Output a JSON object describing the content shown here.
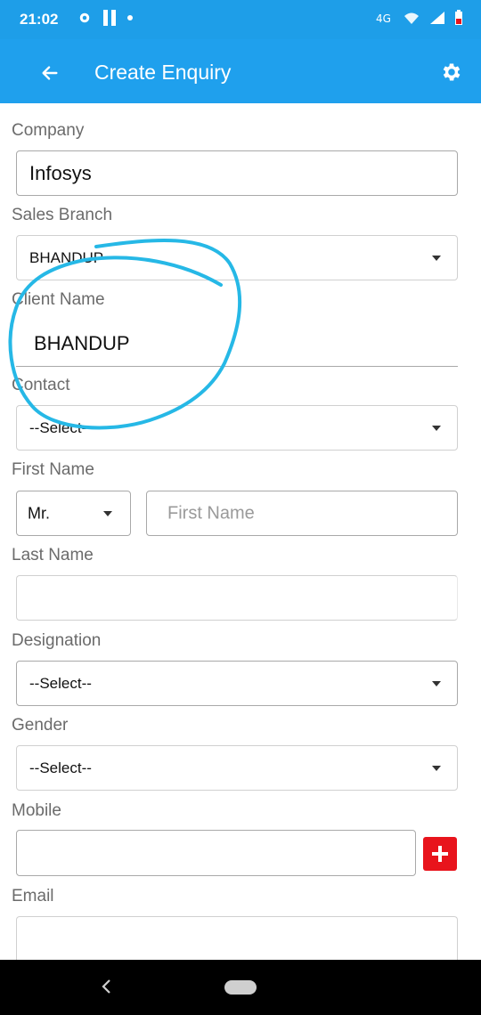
{
  "status_bar": {
    "time": "21:02",
    "icons_left": [
      "settings-icon",
      "pause-icon",
      "dot-icon"
    ],
    "icons_right": [
      "data-icon",
      "wifi-icon",
      "signal-icon",
      "battery-icon"
    ]
  },
  "app_bar": {
    "title": "Create Enquiry",
    "back_icon": "arrow-left-icon",
    "settings_icon": "gear-icon",
    "color": "#1fa0ed"
  },
  "form": {
    "company": {
      "label": "Company",
      "value": "Infosys"
    },
    "sales_branch": {
      "label": "Sales Branch",
      "value": "BHANDUP"
    },
    "client_name": {
      "label": "Client Name",
      "value": "BHANDUP"
    },
    "contact": {
      "label": "Contact",
      "value": "--Select--"
    },
    "first_name": {
      "label": "First Name",
      "salutation": "Mr.",
      "placeholder": "First Name"
    },
    "last_name": {
      "label": "Last Name",
      "value": ""
    },
    "designation": {
      "label": "Designation",
      "value": "--Select--"
    },
    "gender": {
      "label": "Gender",
      "value": "--Select--"
    },
    "mobile": {
      "label": "Mobile",
      "value": "",
      "add_color": "#e8141c"
    },
    "email": {
      "label": "Email",
      "value": ""
    }
  },
  "annotation_color": "#26b8e6"
}
